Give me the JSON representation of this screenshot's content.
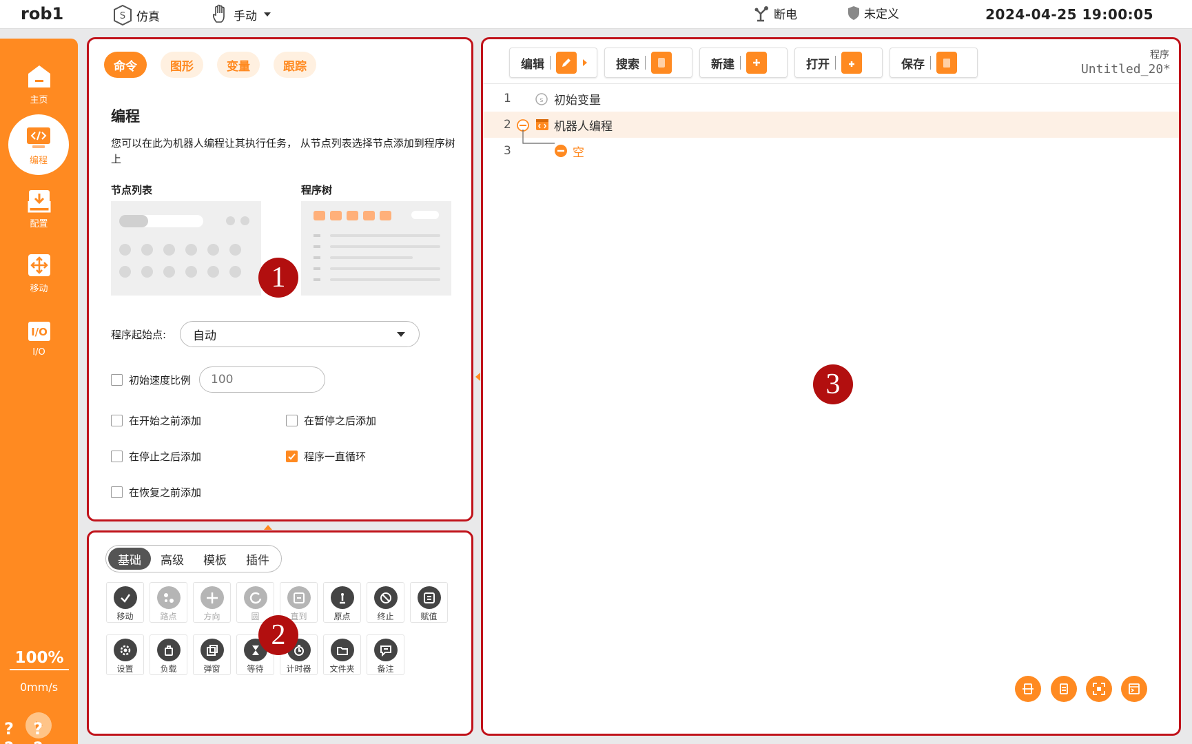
{
  "topbar": {
    "robot_name": "rob1",
    "sim_label": "仿真",
    "mode_label": "手动",
    "power_label": "断电",
    "safety_label": "未定义",
    "datetime": "2024-04-25 19:00:05"
  },
  "sidebar": {
    "items": [
      {
        "label": "主页",
        "icon": "home-icon"
      },
      {
        "label": "编程",
        "icon": "code-icon",
        "active": true
      },
      {
        "label": "配置",
        "icon": "download-icon"
      },
      {
        "label": "移动",
        "icon": "move-icon"
      },
      {
        "label": "I/O",
        "icon": "io-icon"
      }
    ],
    "speed_percent": "100%",
    "speed_value": "0mm/s",
    "help": "? ? ? ?"
  },
  "markers": [
    "1",
    "2",
    "3"
  ],
  "panel1": {
    "tabs": [
      "命令",
      "图形",
      "变量",
      "跟踪"
    ],
    "title": "编程",
    "description": "您可以在此为机器人编程让其执行任务， 从节点列表选择节点添加到程序树上",
    "node_list_label": "节点列表",
    "program_tree_label": "程序树",
    "start_point_label": "程序起始点:",
    "start_point_value": "自动",
    "init_speed_label": "初始速度比例",
    "init_speed_placeholder": "100",
    "checkboxes": [
      {
        "label": "在开始之前添加",
        "checked": false
      },
      {
        "label": "在暂停之后添加",
        "checked": false
      },
      {
        "label": "在停止之后添加",
        "checked": false
      },
      {
        "label": "程序一直循环",
        "checked": true
      },
      {
        "label": "在恢复之前添加",
        "checked": false
      }
    ]
  },
  "panel2": {
    "categories": [
      "基础",
      "高级",
      "模板",
      "插件"
    ],
    "nodes": [
      {
        "label": "移动",
        "icon": "move-node-icon",
        "enabled": true
      },
      {
        "label": "路点",
        "icon": "waypoint-icon",
        "enabled": false
      },
      {
        "label": "方向",
        "icon": "direction-icon",
        "enabled": false
      },
      {
        "label": "圆",
        "icon": "circle-icon",
        "enabled": false
      },
      {
        "label": "直到",
        "icon": "until-icon",
        "enabled": false
      },
      {
        "label": "原点",
        "icon": "origin-icon",
        "enabled": true
      },
      {
        "label": "终止",
        "icon": "stop-icon",
        "enabled": true
      },
      {
        "label": "赋值",
        "icon": "assign-icon",
        "enabled": true
      },
      {
        "label": "设置",
        "icon": "settings-icon",
        "enabled": true
      },
      {
        "label": "负载",
        "icon": "payload-icon",
        "enabled": true
      },
      {
        "label": "弹窗",
        "icon": "popup-icon",
        "enabled": true
      },
      {
        "label": "等待",
        "icon": "wait-icon",
        "enabled": true
      },
      {
        "label": "计时器",
        "icon": "timer-icon",
        "enabled": true
      },
      {
        "label": "文件夹",
        "icon": "folder-icon",
        "enabled": true
      },
      {
        "label": "备注",
        "icon": "comment-icon",
        "enabled": true
      }
    ]
  },
  "panel3": {
    "toolbar": [
      "编辑",
      "搜索",
      "新建",
      "打开",
      "保存"
    ],
    "program_label": "程序",
    "program_name": "Untitled_20*",
    "tree": [
      {
        "line": "1",
        "label": "初始变量"
      },
      {
        "line": "2",
        "label": "机器人编程"
      },
      {
        "line": "3",
        "label": "空"
      }
    ]
  },
  "colors": {
    "accent": "#ff8a21",
    "marker": "#b20f0f",
    "panel_border": "#c0121a"
  }
}
